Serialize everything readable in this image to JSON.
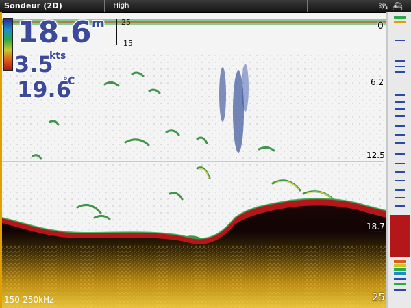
{
  "titlebar": {
    "title": "Sondeur (2D)",
    "mode": "High",
    "icons": [
      "satellite-icon",
      "ship-icon"
    ]
  },
  "readouts": {
    "depth": {
      "value": "18.6",
      "unit": "m"
    },
    "speed": {
      "value": "3.5",
      "unit": "kts"
    },
    "temperature": {
      "value": "19.6",
      "unit": "°C"
    }
  },
  "zoom_window": {
    "top": "25",
    "bottom": "15"
  },
  "depth_scale": {
    "labels": [
      "0",
      "6.2",
      "12.5",
      "18.7",
      "25"
    ]
  },
  "frequency": "150-250kHz",
  "colors": {
    "readout": "#3c4a9c",
    "frame_accent": "#e0a000",
    "bottom_return": "#b4161a"
  }
}
